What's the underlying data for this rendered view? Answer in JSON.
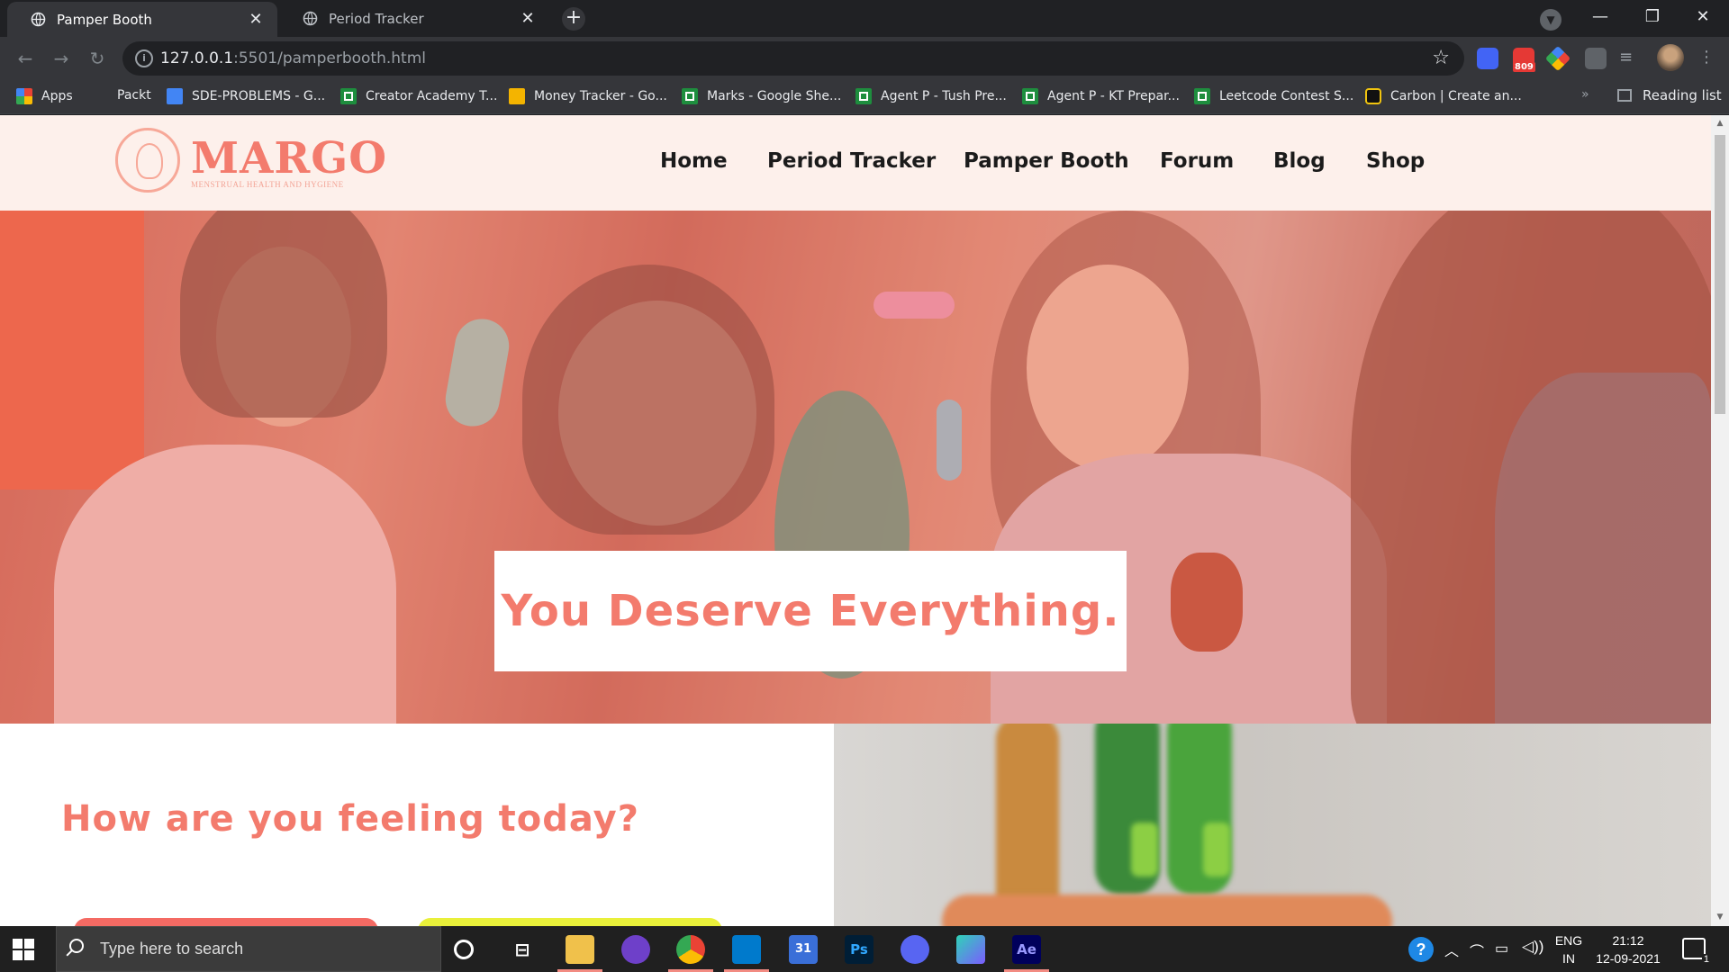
{
  "browser": {
    "tabs": [
      {
        "title": "Pamper Booth",
        "active": true
      },
      {
        "title": "Period Tracker",
        "active": false
      }
    ],
    "new_tab_label": "+",
    "window_controls": {
      "minimize": "—",
      "restore": "❐",
      "close": "✕"
    },
    "address": {
      "host": "127.0.0.1",
      "rest": ":5501/pamperbooth.html"
    },
    "extension_badge": "809",
    "bookmarks": [
      {
        "label": "Apps",
        "icon": "apps-grid-icon"
      },
      {
        "label": "Packt",
        "icon": "none"
      },
      {
        "label": "SDE-PROBLEMS - G...",
        "icon": "docs-icon"
      },
      {
        "label": "Creator Academy T...",
        "icon": "sheets-icon"
      },
      {
        "label": "Money Tracker - Go...",
        "icon": "slides-icon"
      },
      {
        "label": "Marks - Google She...",
        "icon": "sheets-icon"
      },
      {
        "label": "Agent P - Tush Pre...",
        "icon": "sheets-icon"
      },
      {
        "label": "Agent P - KT Prepar...",
        "icon": "sheets-icon"
      },
      {
        "label": "Leetcode Contest S...",
        "icon": "sheets-icon"
      },
      {
        "label": "Carbon | Create an...",
        "icon": "carbon-icon"
      }
    ],
    "bookmarks_more": "»",
    "reading_list": "Reading list"
  },
  "site": {
    "logo": {
      "name": "MARGO",
      "tagline": "MENSTRUAL HEALTH AND HYGIENE"
    },
    "nav": [
      "Home",
      "Period Tracker",
      "Pamper Booth",
      "Forum",
      "Blog",
      "Shop"
    ],
    "hero_text": "You Deserve Everything.",
    "feeling_title": "How are you feeling today?",
    "colors": {
      "accent": "#f37b6d",
      "header_bg": "#fdf0eb",
      "mood_button_1": "#f46a63",
      "mood_button_2": "#e9f03a"
    }
  },
  "taskbar": {
    "search_placeholder": "Type here to search",
    "apps": [
      "cortana-icon",
      "task-view-icon",
      "file-explorer-icon",
      "github-desktop-icon",
      "chrome-icon",
      "vscode-icon",
      "calendar-icon",
      "photoshop-icon",
      "discord-icon",
      "app-icon",
      "after-effects-icon"
    ],
    "calendar_label": "31",
    "photoshop_label": "Ps",
    "after_effects_label": "Ae",
    "language": {
      "line1": "ENG",
      "line2": "IN"
    },
    "time": "21:12",
    "date": "12-09-2021",
    "notification_count": "1"
  }
}
